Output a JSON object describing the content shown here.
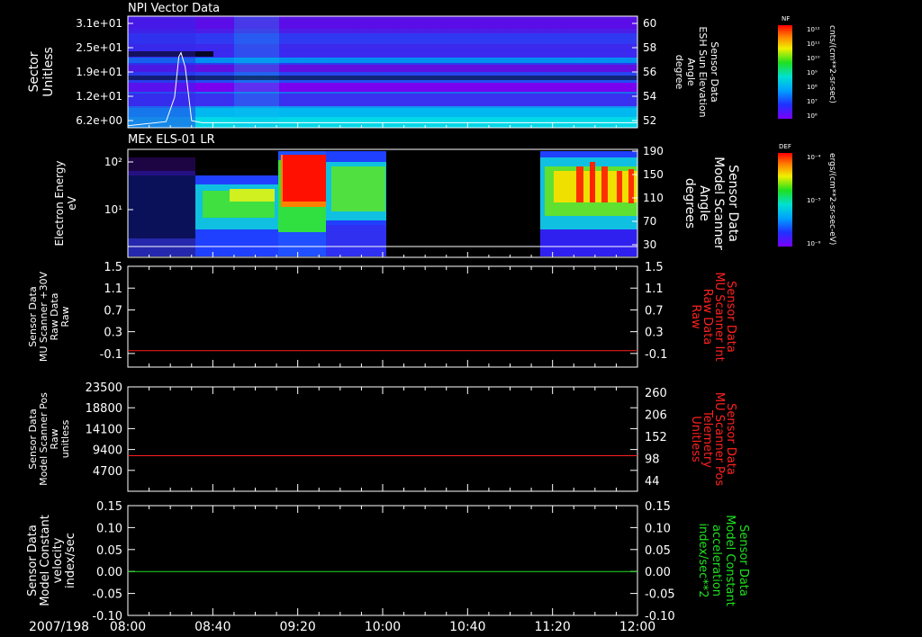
{
  "time_axis": {
    "date": "2007/198",
    "ticks": [
      "08:00",
      "08:40",
      "09:20",
      "10:00",
      "10:40",
      "11:20",
      "12:00"
    ],
    "range": [
      "08:00",
      "12:00"
    ]
  },
  "colors": {
    "background": "#000000",
    "text": "#ffffff",
    "red_line": "#ff2020",
    "green_line": "#20e020",
    "red_label": "#ff2020",
    "green_label": "#20e020"
  },
  "chart_data": [
    {
      "type": "heatmap",
      "title": "NPI Vector Data",
      "ylabel": "Sector\nUnitless",
      "yticks": [
        "3.1e+01",
        "2.5e+01",
        "1.9e+01",
        "1.2e+01",
        "6.2e+00"
      ],
      "y2label": "Sensor Data\nESH Sun Elevation\nAngle\ndegree",
      "y2ticks": [
        "60",
        "58",
        "56",
        "54",
        "52"
      ],
      "colorbar": {
        "label_top": "NF",
        "unit": "cnts/(cm**2-sr-sec)",
        "ticks": [
          "10¹²",
          "10¹¹",
          "10¹⁰",
          "10⁹",
          "10⁸",
          "10⁷",
          "10⁶"
        ]
      },
      "overlay_series": {
        "x": [
          "08:00",
          "08:18",
          "08:22",
          "08:24",
          "08:25",
          "08:27",
          "08:30",
          "08:35",
          "12:00"
        ],
        "y": [
          50.2,
          50.6,
          53,
          57,
          57.4,
          56,
          50.7,
          50.5,
          50.5
        ]
      }
    },
    {
      "type": "heatmap",
      "title": "MEx ELS-01 LR",
      "ylabel": "Electron Energy\neV",
      "yticks": [
        "10²",
        "10¹"
      ],
      "y2label": "Sensor Data\nModel Scanner\nAngle\ndegrees",
      "y2ticks": [
        "190",
        "150",
        "110",
        "70",
        "30"
      ],
      "colorbar": {
        "label_top": "DEF",
        "unit": "ergs/(cm**2-sr-sec-eV)",
        "ticks": [
          "10⁻⁴",
          "10⁻⁵",
          "10⁻⁶"
        ]
      },
      "data_gaps": [
        [
          "10:00",
          "11:18"
        ]
      ]
    },
    {
      "type": "line",
      "ylabel": "Sensor Data\nMU Scanner +30V\nRaw Data\nRaw",
      "yticks": [
        "1.5",
        "1.1",
        "0.7",
        "0.3",
        "-0.1"
      ],
      "y2label": "Sensor Data\nMU Scanner Int\nRaw Data\nRaw",
      "y2ticks": [
        "1.5",
        "1.1",
        "0.7",
        "0.3",
        "-0.1"
      ],
      "ylim": [
        -0.35,
        1.5
      ],
      "series": [
        {
          "x": [
            "08:00",
            "12:00"
          ],
          "y": [
            -0.05,
            -0.05
          ]
        }
      ]
    },
    {
      "type": "line",
      "ylabel": "Sensor Data\nModel Scanner Pos\nRaw\nunitless",
      "yticks": [
        "23500",
        "18800",
        "14100",
        "9400",
        "4700"
      ],
      "y2label": "Sensor Data\nMU Scanner Pos\nTelemetry\nUnitless",
      "y2ticks": [
        "260",
        "206",
        "152",
        "98",
        "44"
      ],
      "ylim": [
        0,
        23500
      ],
      "series": [
        {
          "x": [
            "08:00",
            "12:00"
          ],
          "y": [
            8000,
            8000
          ]
        }
      ]
    },
    {
      "type": "line",
      "ylabel": "Sensor Data\nModel Constant\nvelocity\nindex/sec",
      "yticks": [
        "0.15",
        "0.10",
        "0.05",
        "0.00",
        "-0.05",
        "-0.10"
      ],
      "y2label": "Sensor Data\nModel Constant\nacceleration\nindex/sec**2",
      "y2ticks": [
        "0.15",
        "0.10",
        "0.05",
        "0.00",
        "-0.05",
        "-0.10"
      ],
      "ylim": [
        -0.1,
        0.15
      ],
      "series": [
        {
          "x": [
            "08:00",
            "12:00"
          ],
          "y": [
            0.0,
            0.0
          ]
        }
      ]
    }
  ]
}
